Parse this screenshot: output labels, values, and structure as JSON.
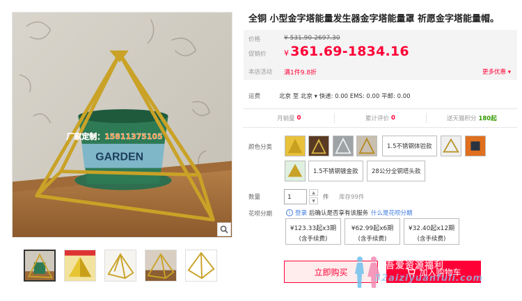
{
  "product": {
    "title": "全铜 小型金字塔能量发生器金字塔能量罩 祈愿金字塔能量帽。",
    "image_overlay_text": "厂家定制：15811375105",
    "pot_text": "GARDEN"
  },
  "price": {
    "label": "价格",
    "original": "¥ 531.90-2697.30",
    "promo_label": "促销价",
    "currency": "¥",
    "promo_value": "361.69-1834.16",
    "activity_label": "本店活动",
    "activity_value": "满1件9.8折",
    "more_label": "更多优惠"
  },
  "shipping": {
    "label": "运费",
    "text": "北京 至 北京 ▾ 快递: 0.00 EMS: 0.00 平邮: 0.00"
  },
  "stats": [
    {
      "label": "月销量",
      "value": "0"
    },
    {
      "label": "累计评价",
      "value": "0"
    },
    {
      "label": "送天猫积分",
      "value": "180起"
    }
  ],
  "sku": {
    "label": "颜色分类",
    "options": [
      "1.5不锈钢体验款",
      "1.5不锈钢镀金款",
      "28公分全铜塔头款"
    ]
  },
  "quantity": {
    "label": "数量",
    "value": "1",
    "unit": "件",
    "stock": "库存99件"
  },
  "huabei": {
    "label": "花呗分期",
    "notice_link": "登录",
    "notice_text": "后确认是否享有该服务",
    "what_link": "什么是花呗分期",
    "plans": [
      {
        "amount": "¥123.33起",
        "periods": "x3期",
        "fee": "(含手续费)"
      },
      {
        "amount": "¥62.99起",
        "periods": "x6期",
        "fee": "(含手续费)"
      },
      {
        "amount": "¥32.40起",
        "periods": "x12期",
        "fee": "(含手续费)"
      }
    ]
  },
  "actions": {
    "buy_now": "立即购买",
    "add_cart": "加入购物车"
  },
  "watermark": {
    "text": "吾爱资源福利",
    "url": "52aiziyuanfuli.com"
  },
  "colors": {
    "accent": "#ff0036",
    "points": "#339900",
    "link": "#3d7ae0",
    "gold": "#c9a227"
  },
  "icons": [
    "search-zoom-icon",
    "info-icon",
    "cart-icon",
    "chevron-down-icon"
  ]
}
